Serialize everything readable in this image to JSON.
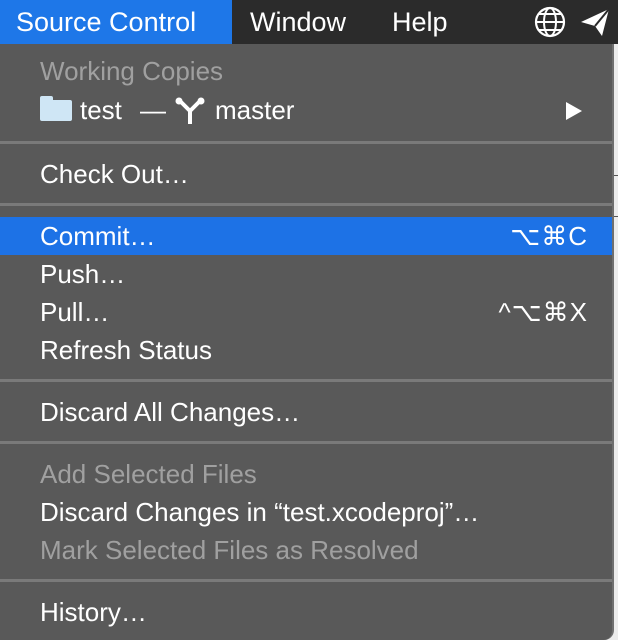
{
  "menubar": {
    "items": [
      {
        "label": "Source Control",
        "active": true
      },
      {
        "label": "Window",
        "active": false
      },
      {
        "label": "Help",
        "active": false
      }
    ],
    "icons": [
      "globe-icon",
      "send-icon"
    ]
  },
  "menu": {
    "working_copies_header": "Working Copies",
    "working_copy": {
      "name": "test",
      "dash": "—",
      "branch": "master"
    },
    "check_out": "Check Out…",
    "commit": {
      "label": "Commit…",
      "shortcut": "⌥⌘C"
    },
    "push": "Push…",
    "pull": {
      "label": "Pull…",
      "shortcut": "^⌥⌘X"
    },
    "refresh_status": "Refresh Status",
    "discard_all": "Discard All Changes…",
    "add_selected": "Add Selected Files",
    "discard_changes_in": "Discard Changes in “test.xcodeproj”…",
    "mark_resolved": "Mark Selected Files as Resolved",
    "history": "History…"
  },
  "colors": {
    "menubar_bg": "#2b2b2b",
    "menu_bg": "#595959",
    "highlight": "#1d72e6",
    "disabled_text": "#a0a0a0"
  }
}
